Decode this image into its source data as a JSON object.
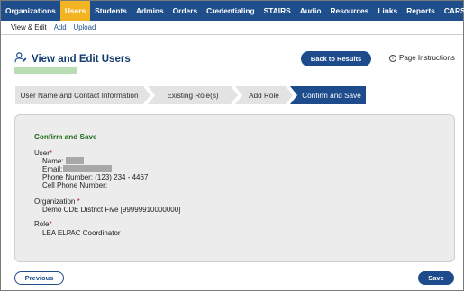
{
  "topnav": {
    "items": [
      {
        "label": "Organizations",
        "active": false
      },
      {
        "label": "Users",
        "active": true
      },
      {
        "label": "Students",
        "active": false
      },
      {
        "label": "Admins",
        "active": false
      },
      {
        "label": "Orders",
        "active": false
      },
      {
        "label": "Credentialing",
        "active": false
      },
      {
        "label": "STAIRS",
        "active": false
      },
      {
        "label": "Audio",
        "active": false
      },
      {
        "label": "Resources",
        "active": false
      },
      {
        "label": "Links",
        "active": false
      },
      {
        "label": "Reports",
        "active": false
      },
      {
        "label": "CARS",
        "active": false
      }
    ],
    "colors": {
      "background": "#1f4e8c",
      "active": "#f2b422"
    }
  },
  "subnav": {
    "items": [
      {
        "label": "View & Edit",
        "active": true
      },
      {
        "label": "Add",
        "active": false
      },
      {
        "label": "Upload",
        "active": false
      }
    ]
  },
  "header": {
    "title": "View and Edit Users",
    "title_icon": "user-edit-icon",
    "back_button": "Back to Results",
    "instructions_link": "Page Instructions",
    "instructions_icon": "info-icon"
  },
  "steps": [
    {
      "label": "User Name and Contact Information",
      "active": false
    },
    {
      "label": "Existing Role(s)",
      "active": false
    },
    {
      "label": "Add Role",
      "active": false
    },
    {
      "label": "Confirm and Save",
      "active": true
    }
  ],
  "confirm": {
    "heading": "Confirm and Save",
    "user_label": "User",
    "name_label": "Name:",
    "email_label": "Email:",
    "phone": "Phone Number: (123) 234 - 4467",
    "cell_phone": "Cell Phone Number:",
    "org_label": "Organization",
    "org_value": "Demo CDE District Five [99999910000000]",
    "role_label": "Role",
    "role_value": "LEA ELPAC Coordinator",
    "required_mark": "*"
  },
  "footer": {
    "previous": "Previous",
    "save": "Save"
  },
  "colors": {
    "primary": "#1d4b8b",
    "heading_green": "#1e6b1e",
    "required_red": "#c21c1c",
    "panel_bg": "#ececec"
  }
}
